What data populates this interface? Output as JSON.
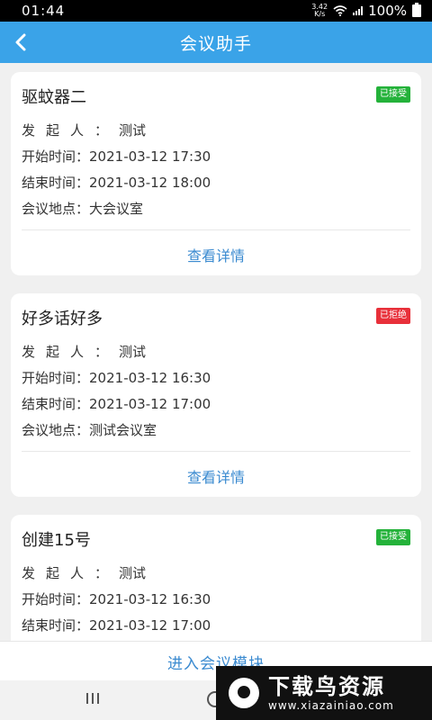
{
  "status_bar": {
    "time": "01:44",
    "net_speed_value": "3.42",
    "net_speed_unit": "K/s",
    "battery": "100%"
  },
  "header": {
    "title": "会议助手"
  },
  "labels": {
    "initiator": "发起人：",
    "start": "开始时间：",
    "end": "结束时间：",
    "location": "会议地点：",
    "detail": "查看详情"
  },
  "meetings": [
    {
      "title": "驱蚊器二",
      "status": "已接受",
      "initiator": "测试",
      "start": "2021-03-12 17:30",
      "end": "2021-03-12 18:00",
      "location": "大会议室"
    },
    {
      "title": "好多话好多",
      "status": "已拒绝",
      "initiator": "测试",
      "start": "2021-03-12 16:30",
      "end": "2021-03-12 17:00",
      "location": "测试会议室"
    },
    {
      "title": "创建15号",
      "status": "已接受",
      "initiator": "测试",
      "start": "2021-03-12 16:30",
      "end": "2021-03-12 17:00"
    }
  ],
  "bottom": {
    "enter_label": "进入会议模块"
  },
  "watermark": {
    "title": "下载鸟资源",
    "url": "www.xiazainiao.com"
  },
  "colors": {
    "header": "#3aa3e8",
    "accepted": "#24b23a",
    "rejected": "#e8303a",
    "link": "#3a8ad0"
  },
  "icons": {
    "back": "chevron-left-icon",
    "wifi": "wifi-icon",
    "signal": "signal-icon",
    "battery": "battery-icon"
  }
}
